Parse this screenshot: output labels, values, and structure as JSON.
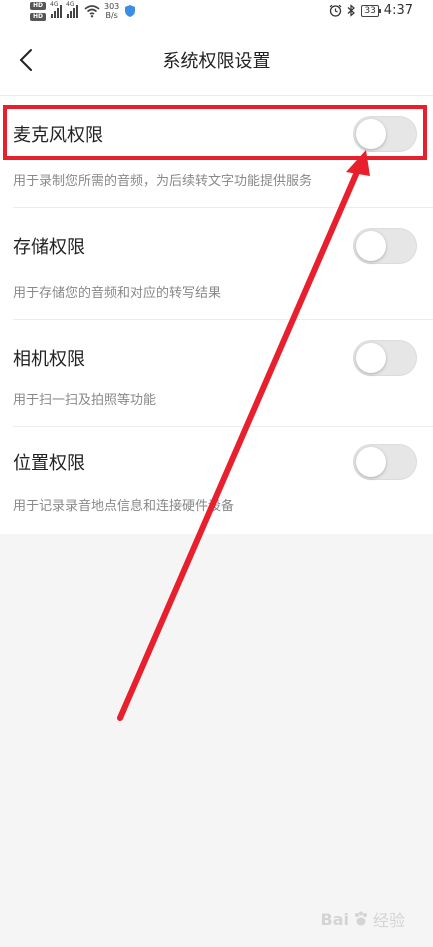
{
  "status_bar": {
    "hd_labels": [
      "HD",
      "HD"
    ],
    "network_1": "4G",
    "network_2": "4G",
    "speed_value": "303",
    "speed_unit": "B/s",
    "battery": "33",
    "time": "4:37"
  },
  "header": {
    "title": "系统权限设置"
  },
  "permissions": [
    {
      "label": "麦克风权限",
      "description": "用于录制您所需的音频，为后续转文字功能提供服务",
      "enabled": false
    },
    {
      "label": "存储权限",
      "description": "用于存储您的音频和对应的转写结果",
      "enabled": false
    },
    {
      "label": "相机权限",
      "description": "用于扫一扫及拍照等功能",
      "enabled": false
    },
    {
      "label": "位置权限",
      "description": "用于记录录音地点信息和连接硬件设备",
      "enabled": false
    }
  ],
  "annotation": {
    "color": "#e8202e"
  },
  "watermark": {
    "brand": "Bai",
    "suffix": "经验"
  }
}
